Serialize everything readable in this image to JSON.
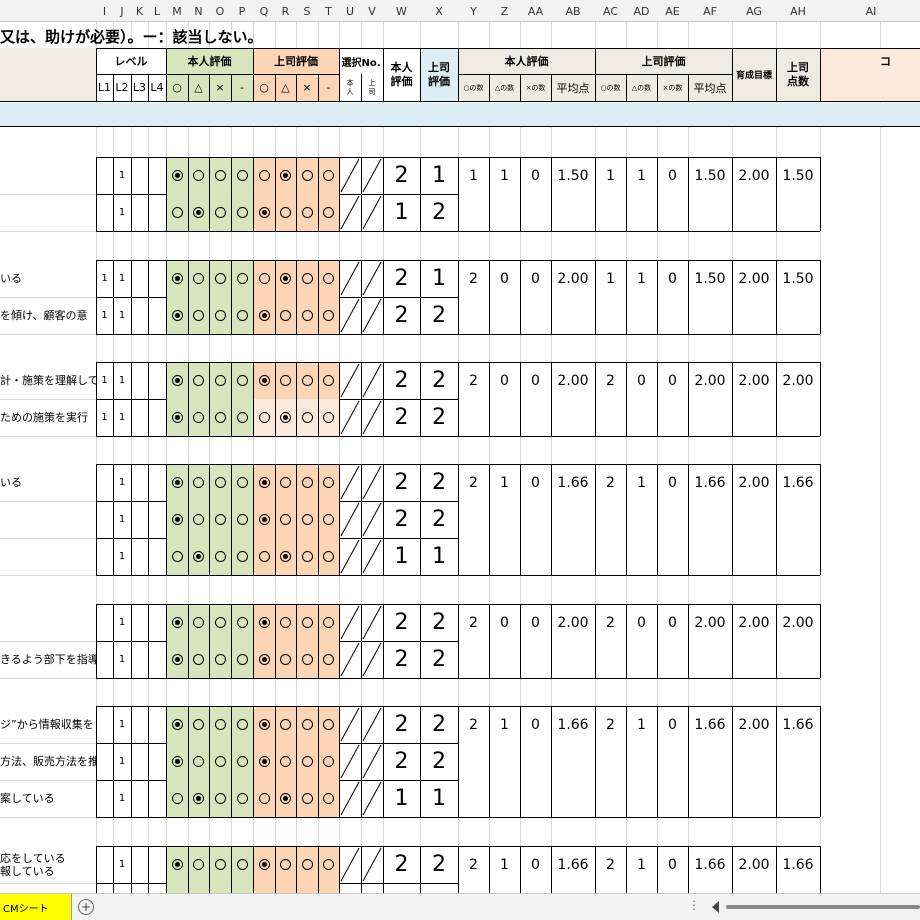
{
  "columns": [
    "I",
    "J",
    "K",
    "L",
    "M",
    "N",
    "O",
    "P",
    "Q",
    "R",
    "S",
    "T",
    "U",
    "V",
    "W",
    "X",
    "Y",
    "Z",
    "AA",
    "AB",
    "AC",
    "AD",
    "AE",
    "AF",
    "AG",
    "AH",
    "AI"
  ],
  "sheet": {
    "title": "又は、助けが必要）。ー：該当しない。",
    "header": {
      "level": "レベル",
      "level_labels": [
        "L1",
        "L2",
        "L3",
        "L4"
      ],
      "self_eval": "本人評価",
      "boss_eval": "上司評価",
      "marks": [
        "○",
        "△",
        "×",
        "-"
      ],
      "select_no": "選択No.",
      "honin": "本\n人",
      "joushi": "上\n司",
      "self_score_hdr": "本人\n評価",
      "boss_score_hdr": "上司\n評価",
      "self_sum": "本人評価",
      "boss_sum": "上司評価",
      "cnt_labels": [
        "○の数",
        "△の数",
        "×の数"
      ],
      "avg": "平均点",
      "target": "育成目標",
      "boss_points": "上司\n点数",
      "comment": "コ"
    },
    "groups": [
      {
        "rows": [
          {
            "text": "",
            "l1": "",
            "l2": "1",
            "self": 0,
            "boss": 1,
            "s": "2",
            "b": "1"
          },
          {
            "text": "",
            "l1": "",
            "l2": "1",
            "self": 1,
            "boss": 0,
            "s": "1",
            "b": "2"
          }
        ],
        "summary": {
          "sc": "1",
          "sd": "1",
          "sx": "0",
          "savg": "1.50",
          "bc": "1",
          "bd": "1",
          "bx": "0",
          "bavg": "1.50",
          "target": "2.00",
          "points": "1.50"
        }
      },
      {
        "rows": [
          {
            "text": "いる",
            "l1": "1",
            "l2": "1",
            "self": 0,
            "boss": 1,
            "s": "2",
            "b": "1"
          },
          {
            "text": "を傾け、顧客の意",
            "l1": "1",
            "l2": "1",
            "self": 0,
            "boss": 0,
            "s": "2",
            "b": "2"
          }
        ],
        "summary": {
          "sc": "2",
          "sd": "0",
          "sx": "0",
          "savg": "2.00",
          "bc": "1",
          "bd": "1",
          "bx": "0",
          "bavg": "1.50",
          "target": "2.00",
          "points": "1.50"
        }
      },
      {
        "rows": [
          {
            "text": "計・施策を理解して",
            "l1": "1",
            "l2": "1",
            "self": 0,
            "boss": 0,
            "s": "2",
            "b": "2"
          },
          {
            "text": "ための施策を実行",
            "l1": "1",
            "l2": "1",
            "self": 0,
            "boss": 1,
            "s": "2",
            "b": "2"
          }
        ],
        "summary": {
          "sc": "2",
          "sd": "0",
          "sx": "0",
          "savg": "2.00",
          "bc": "2",
          "bd": "0",
          "bx": "0",
          "bavg": "2.00",
          "target": "2.00",
          "points": "2.00"
        }
      },
      {
        "rows": [
          {
            "text": "いる",
            "l1": "",
            "l2": "1",
            "self": 0,
            "boss": 0,
            "s": "2",
            "b": "2"
          },
          {
            "text": "",
            "l1": "",
            "l2": "1",
            "self": 0,
            "boss": 0,
            "s": "2",
            "b": "2"
          },
          {
            "text": "",
            "l1": "",
            "l2": "1",
            "self": 1,
            "boss": 1,
            "s": "1",
            "b": "1"
          }
        ],
        "summary": {
          "sc": "2",
          "sd": "1",
          "sx": "0",
          "savg": "1.66",
          "bc": "2",
          "bd": "1",
          "bx": "0",
          "bavg": "1.66",
          "target": "2.00",
          "points": "1.66"
        }
      },
      {
        "rows": [
          {
            "text": "",
            "l1": "",
            "l2": "1",
            "self": 0,
            "boss": 0,
            "s": "2",
            "b": "2"
          },
          {
            "text": "きるよう部下を指導",
            "l1": "",
            "l2": "1",
            "self": 0,
            "boss": 0,
            "s": "2",
            "b": "2"
          }
        ],
        "summary": {
          "sc": "2",
          "sd": "0",
          "sx": "0",
          "savg": "2.00",
          "bc": "2",
          "bd": "0",
          "bx": "0",
          "bavg": "2.00",
          "target": "2.00",
          "points": "2.00"
        }
      },
      {
        "rows": [
          {
            "text": "ジ”から情報収集を",
            "l1": "",
            "l2": "1",
            "self": 0,
            "boss": 0,
            "s": "2",
            "b": "2"
          },
          {
            "text": "方法、販売方法を推",
            "l1": "",
            "l2": "1",
            "self": 0,
            "boss": 0,
            "s": "2",
            "b": "2"
          },
          {
            "text": "案している",
            "l1": "",
            "l2": "1",
            "self": 1,
            "boss": 1,
            "s": "1",
            "b": "1"
          }
        ],
        "summary": {
          "sc": "2",
          "sd": "1",
          "sx": "0",
          "savg": "1.66",
          "bc": "2",
          "bd": "1",
          "bx": "0",
          "bavg": "1.66",
          "target": "2.00",
          "points": "1.66"
        }
      },
      {
        "rows": [
          {
            "text": "応をしている\n報している",
            "l1": "",
            "l2": "1",
            "self": 0,
            "boss": 0,
            "s": "2",
            "b": "2"
          },
          {
            "text": "",
            "l1": "",
            "l2": "",
            "self": -1,
            "boss": -1,
            "s": "",
            "b": ""
          }
        ],
        "summary": {
          "sc": "2",
          "sd": "1",
          "sx": "0",
          "savg": "1.66",
          "bc": "2",
          "bd": "1",
          "bx": "0",
          "bavg": "1.66",
          "target": "2.00",
          "points": "1.66"
        }
      }
    ]
  },
  "tabs": {
    "sheet_name": "CMシート",
    "add_symbol": "+",
    "menu_symbol": "⋮"
  },
  "colors": {
    "green": "#d8e4bc",
    "orange": "#fcd5b4",
    "orange_light": "#fde9d9",
    "blue": "#daeef3",
    "beige": "#eeece1",
    "header_gray": "#f2f2f2",
    "tab_yellow": "#ffff00"
  }
}
